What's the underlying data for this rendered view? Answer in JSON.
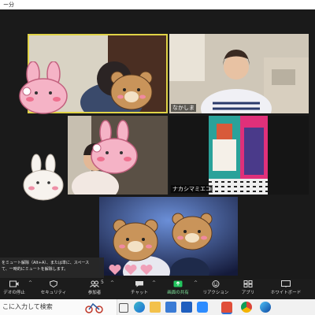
{
  "window": {
    "title": "ー分"
  },
  "participants": [
    {
      "name": ""
    },
    {
      "name": "なかしま"
    },
    {
      "name": ""
    },
    {
      "name": "ナカシマミエコ"
    },
    {
      "name": ""
    }
  ],
  "tooltip": {
    "line1": "をミュート解除（Alt+A）、または単に、スペース",
    "line2": "て、一時的にミュートを解除します。"
  },
  "toolbar": {
    "items": [
      {
        "label": "デオの停止",
        "icon": "video-icon"
      },
      {
        "label": "セキュリティ",
        "icon": "shield-icon"
      },
      {
        "label": "参加者",
        "icon": "participants-icon"
      },
      {
        "label": "チャット",
        "icon": "chat-icon"
      },
      {
        "label": "画面の共有",
        "icon": "share-screen-icon"
      },
      {
        "label": "リアクション",
        "icon": "reaction-icon"
      },
      {
        "label": "アプリ",
        "icon": "apps-icon"
      },
      {
        "label": "ホワイトボード",
        "icon": "whiteboard-icon"
      }
    ],
    "participant_count": "5",
    "share_color": "#22c55e"
  },
  "taskbar": {
    "search_placeholder": "こに入力して検索",
    "apps": [
      "illustration-icon",
      "task-view-icon",
      "edge-icon",
      "file-explorer-icon",
      "store-icon",
      "mail-icon",
      "zoom-icon",
      "chrome-icon",
      "edge-icon-2"
    ]
  }
}
